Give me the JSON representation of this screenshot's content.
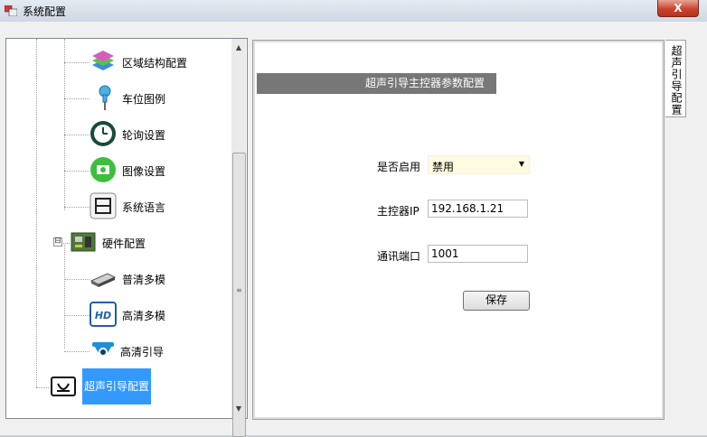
{
  "window": {
    "title": "系统配置",
    "close_label": "X"
  },
  "tree": {
    "items": [
      {
        "label": "区域结构配置",
        "icon": "region-layers-icon"
      },
      {
        "label": "车位图例",
        "icon": "pushpin-icon"
      },
      {
        "label": "轮询设置",
        "icon": "clock-icon"
      },
      {
        "label": "图像设置",
        "icon": "camera-icon"
      },
      {
        "label": "系统语言",
        "icon": "language-icon"
      },
      {
        "label": "硬件配置",
        "icon": "circuit-board-icon",
        "expander": "⊟"
      },
      {
        "label": "普清多模",
        "icon": "device-icon"
      },
      {
        "label": "高清多模",
        "icon": "hd-icon"
      },
      {
        "label": "高清引导",
        "icon": "dome-camera-icon"
      },
      {
        "label": "超声引导配置",
        "icon": "ultrasonic-icon",
        "selected": true
      }
    ]
  },
  "scrollbar": {
    "grip": "≡"
  },
  "panel": {
    "header": "超声引导主控器参数配置",
    "enable_label": "是否启用",
    "enable_value": "禁用",
    "ip_label": "主控器IP",
    "ip_value": "192.168.1.21",
    "port_label": "通讯端口",
    "port_value": "1001",
    "save_label": "保存"
  },
  "tab": {
    "label": "超声引导配置"
  },
  "colors": {
    "selection": "#3399ff",
    "header_bg": "#777777",
    "combo_bg": "#fffbe0"
  }
}
